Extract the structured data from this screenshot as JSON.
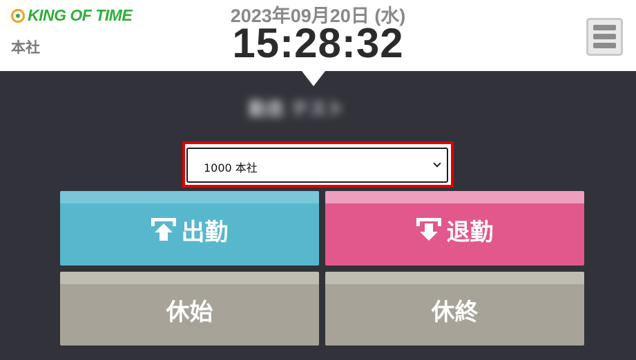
{
  "header": {
    "logo_text": "KING OF TIME",
    "office": "本社",
    "date": "2023年09月20日 (水)",
    "time": "15:28:32"
  },
  "user": {
    "name": "勤怠 テスト"
  },
  "office_select": {
    "selected": "1000 本社"
  },
  "buttons": {
    "clock_in": "出勤",
    "clock_out": "退勤",
    "break_start": "休始",
    "break_end": "休終"
  },
  "colors": {
    "background": "#32323a",
    "clock_in": "#57b7cd",
    "clock_out": "#e2588c",
    "break": "#a7a398",
    "highlight_frame": "#e00000",
    "logo": "#2fae3a"
  },
  "icons": {
    "menu": "hamburger-icon",
    "clock_in": "arrow-up-icon",
    "clock_out": "arrow-down-icon",
    "logo": "clock-logo-icon"
  }
}
